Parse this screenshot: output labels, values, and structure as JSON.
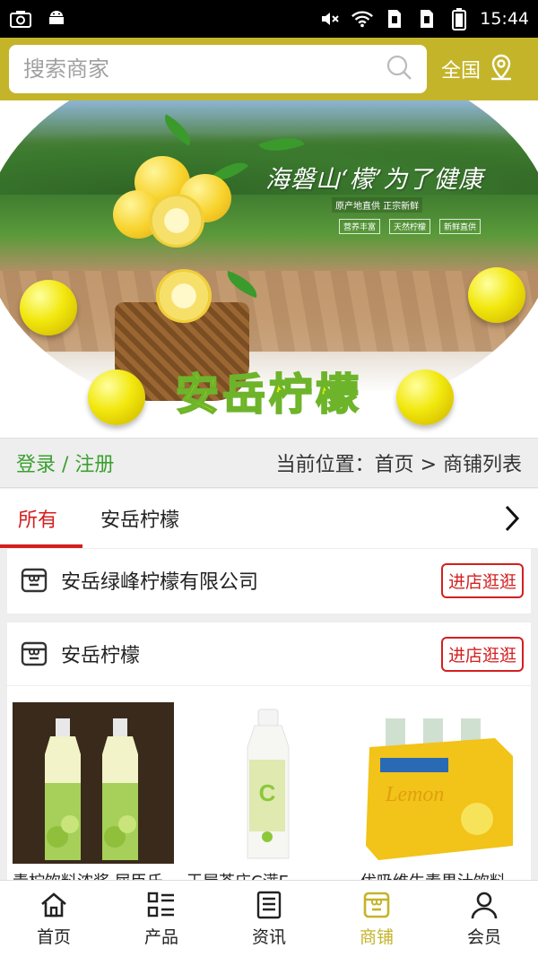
{
  "statusbar": {
    "time": "15:44"
  },
  "header": {
    "search_placeholder": "搜索商家",
    "region": "全国",
    "accent": "#c4b429"
  },
  "banner": {
    "slogan": "海磐山‘檬’为了健康",
    "sub": "原产地直供 正宗新鲜",
    "tags": [
      "营养丰富",
      "天然柠檬",
      "新鲜直供"
    ],
    "brand_title": "安岳柠檬"
  },
  "crumb": {
    "login": "登录 / 注册",
    "location": "当前位置：首页 > 商铺列表"
  },
  "tabs": [
    {
      "label": "所有",
      "active": true
    },
    {
      "label": "安岳柠檬",
      "active": false
    }
  ],
  "stores": [
    {
      "name": "安岳绿峰柠檬有限公司",
      "button": "进店逛逛"
    },
    {
      "name": "安岳柠檬",
      "button": "进店逛逛",
      "products": [
        {
          "name": "青柠饮料浓浆 屈臣氏"
        },
        {
          "name": "王屋茶庄C满E"
        },
        {
          "name": "优吸维生素果汁饮料"
        }
      ]
    }
  ],
  "bottom_nav": [
    {
      "label": "首页",
      "icon": "home-icon",
      "active": false
    },
    {
      "label": "产品",
      "icon": "grid-list-icon",
      "active": false
    },
    {
      "label": "资讯",
      "icon": "news-icon",
      "active": false
    },
    {
      "label": "商铺",
      "icon": "shop-icon",
      "active": true
    },
    {
      "label": "会员",
      "icon": "user-icon",
      "active": false
    }
  ]
}
